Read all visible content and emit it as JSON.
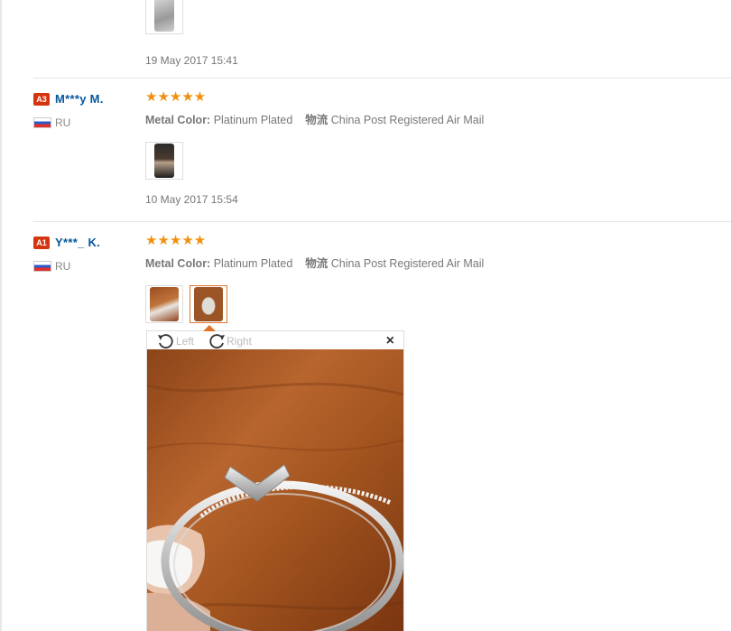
{
  "reviews": [
    {
      "date": "19 May 2017 15:41"
    },
    {
      "level": "A3",
      "user": "M***y M.",
      "country": "RU",
      "stars": "★★★★★",
      "color_label": "Metal Color:",
      "color_value": "Platinum Plated",
      "ship_label": "物流",
      "ship_value": "China Post Registered Air Mail",
      "date": "10 May 2017 15:54"
    },
    {
      "level": "A1",
      "user": "Y***_ K.",
      "country": "RU",
      "stars": "★★★★★",
      "color_label": "Metal Color:",
      "color_value": "Platinum Plated",
      "ship_label": "物流",
      "ship_value": "China Post Registered Air Mail"
    }
  ],
  "viewer": {
    "rotate_left": "Left",
    "rotate_right": "Right",
    "close": "×"
  },
  "colors": {
    "accent": "#e0722a",
    "username": "#05579c",
    "stars": "#f0900c",
    "level_badge": "#d4350f"
  }
}
